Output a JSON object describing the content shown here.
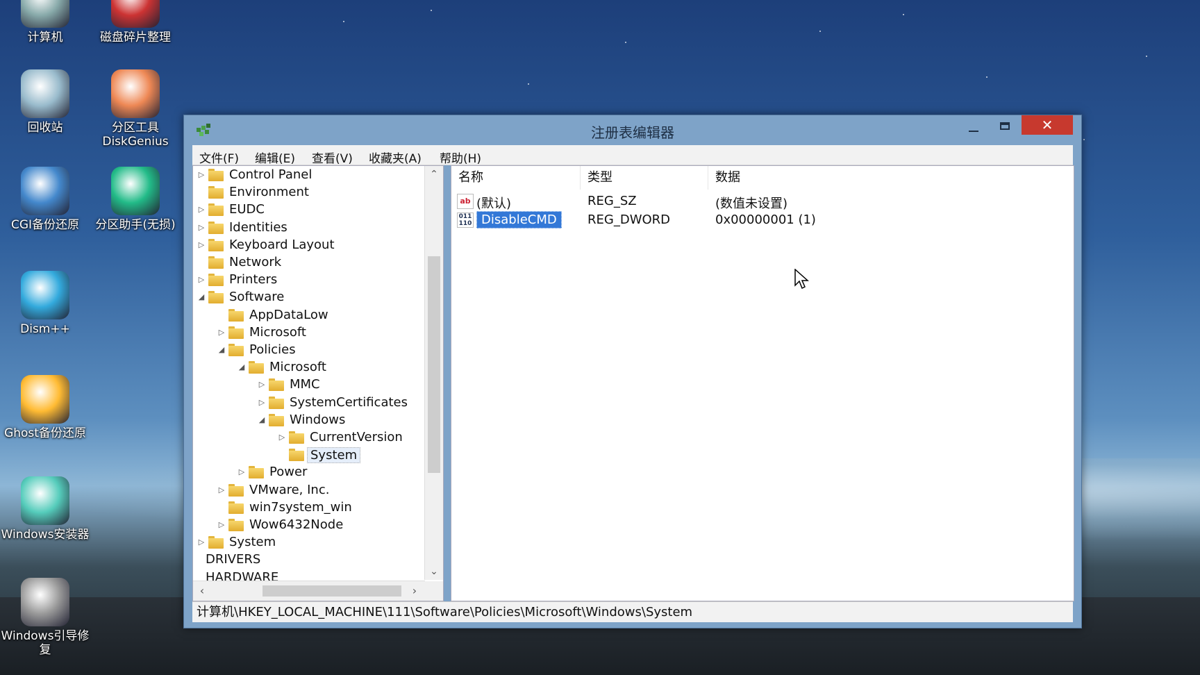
{
  "desktop": {
    "icons": [
      {
        "label": "计算机",
        "icon": "computer-icon"
      },
      {
        "label": "磁盘碎片整理",
        "icon": "defrag-icon"
      },
      {
        "label": "回收站",
        "icon": "recycle-bin-icon"
      },
      {
        "label": "分区工具\nDiskGenius",
        "icon": "diskgenius-icon"
      },
      {
        "label": "CGI备份还原",
        "icon": "cgi-backup-icon"
      },
      {
        "label": "分区助手(无损)",
        "icon": "partition-assistant-icon"
      },
      {
        "label": "Dism++",
        "icon": "dism-icon"
      },
      {
        "label": "Ghost备份还原",
        "icon": "ghost-icon"
      },
      {
        "label": "Windows安装器",
        "icon": "windows-installer-icon"
      },
      {
        "label": "Windows引导修复",
        "icon": "boot-repair-icon"
      }
    ]
  },
  "window": {
    "title": "注册表编辑器",
    "close_glyph": "✕",
    "menu": [
      "文件(F)",
      "编辑(E)",
      "查看(V)",
      "收藏夹(A)",
      "帮助(H)"
    ],
    "tree": [
      {
        "label": "Control Panel",
        "level": 0,
        "state": "collapsed"
      },
      {
        "label": "Environment",
        "level": 0,
        "state": "none"
      },
      {
        "label": "EUDC",
        "level": 0,
        "state": "collapsed"
      },
      {
        "label": "Identities",
        "level": 0,
        "state": "collapsed"
      },
      {
        "label": "Keyboard Layout",
        "level": 0,
        "state": "collapsed"
      },
      {
        "label": "Network",
        "level": 0,
        "state": "none"
      },
      {
        "label": "Printers",
        "level": 0,
        "state": "collapsed"
      },
      {
        "label": "Software",
        "level": 0,
        "state": "expanded"
      },
      {
        "label": "AppDataLow",
        "level": 1,
        "state": "none"
      },
      {
        "label": "Microsoft",
        "level": 1,
        "state": "collapsed"
      },
      {
        "label": "Policies",
        "level": 1,
        "state": "expanded"
      },
      {
        "label": "Microsoft",
        "level": 2,
        "state": "expanded"
      },
      {
        "label": "MMC",
        "level": 3,
        "state": "collapsed"
      },
      {
        "label": "SystemCertificates",
        "level": 3,
        "state": "collapsed"
      },
      {
        "label": "Windows",
        "level": 3,
        "state": "expanded"
      },
      {
        "label": "CurrentVersion",
        "level": 4,
        "state": "collapsed"
      },
      {
        "label": "System",
        "level": 4,
        "state": "none",
        "selected": true
      },
      {
        "label": "Power",
        "level": 2,
        "state": "collapsed"
      },
      {
        "label": "VMware, Inc.",
        "level": 1,
        "state": "collapsed"
      },
      {
        "label": "win7system_win",
        "level": 1,
        "state": "none"
      },
      {
        "label": "Wow6432Node",
        "level": 1,
        "state": "collapsed"
      },
      {
        "label": "System",
        "level": 0,
        "state": "collapsed"
      },
      {
        "label": "DRIVERS",
        "level": -1,
        "state": "none"
      },
      {
        "label": "HARDWARE",
        "level": -1,
        "state": "none"
      }
    ],
    "columns": {
      "name": "名称",
      "type": "类型",
      "data": "数据"
    },
    "values": [
      {
        "icon": "ab",
        "name": "(默认)",
        "type": "REG_SZ",
        "data": "(数值未设置)"
      },
      {
        "icon": "bin",
        "name": "DisableCMD",
        "type": "REG_DWORD",
        "data": "0x00000001 (1)",
        "selected": true
      }
    ],
    "status": "计算机\\HKEY_LOCAL_MACHINE\\111\\Software\\Policies\\Microsoft\\Windows\\System"
  }
}
